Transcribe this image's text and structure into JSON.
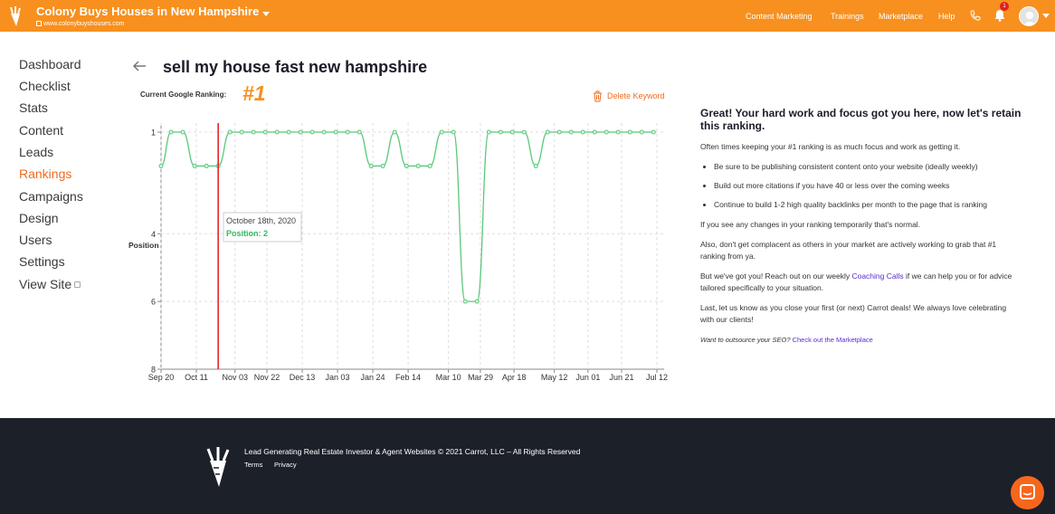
{
  "header": {
    "site_title": "Colony Buys Houses in New Hampshire",
    "site_url": "www.colonybuyshouses.com",
    "nav": [
      {
        "label": "Content Marketing"
      },
      {
        "label": "Trainings"
      },
      {
        "label": "Marketplace"
      },
      {
        "label": "Help"
      }
    ],
    "notification_count": "1",
    "brand_color": "#f7901e"
  },
  "sidebar": {
    "items": [
      {
        "label": "Dashboard"
      },
      {
        "label": "Checklist"
      },
      {
        "label": "Stats"
      },
      {
        "label": "Content"
      },
      {
        "label": "Leads"
      },
      {
        "label": "Rankings",
        "active": true
      },
      {
        "label": "Campaigns"
      },
      {
        "label": "Design"
      },
      {
        "label": "Users"
      },
      {
        "label": "Settings"
      },
      {
        "label": "View Site"
      }
    ]
  },
  "main": {
    "keyword": "sell my house fast new hampshire",
    "current_ranking_label": "Current Google Ranking:",
    "current_ranking_value": "#1",
    "delete_label": "Delete Keyword"
  },
  "chart_data": {
    "type": "line",
    "ylabel": "Position",
    "ylim": [
      8,
      1
    ],
    "y_ticks": [
      "1",
      "4",
      "6",
      "8"
    ],
    "x_ticks": [
      "Sep 20",
      "Oct 11",
      "Nov 03",
      "Nov 22",
      "Dec 13",
      "Jan 03",
      "Jan 24",
      "Feb 14",
      "Mar 10",
      "Mar 29",
      "Apr 18",
      "May 12",
      "Jun 01",
      "Jun 21",
      "Jul 12"
    ],
    "x_tick_days": [
      0,
      21,
      44,
      63,
      84,
      105,
      126,
      147,
      171,
      190,
      210,
      234,
      254,
      274,
      295
    ],
    "series": [
      {
        "color": "#5ac87a",
        "points": [
          [
            0,
            2
          ],
          [
            6,
            1
          ],
          [
            13,
            1
          ],
          [
            20,
            2
          ],
          [
            27,
            2
          ],
          [
            34,
            2
          ],
          [
            41,
            1
          ],
          [
            48,
            1
          ],
          [
            55,
            1
          ],
          [
            62,
            1
          ],
          [
            69,
            1
          ],
          [
            76,
            1
          ],
          [
            83,
            1
          ],
          [
            90,
            1
          ],
          [
            97,
            1
          ],
          [
            104,
            1
          ],
          [
            111,
            1
          ],
          [
            118,
            1
          ],
          [
            125,
            2
          ],
          [
            132,
            2
          ],
          [
            139,
            1
          ],
          [
            146,
            2
          ],
          [
            153,
            2
          ],
          [
            160,
            2
          ],
          [
            167,
            1
          ],
          [
            174,
            1
          ],
          [
            181,
            6
          ],
          [
            188,
            6
          ],
          [
            195,
            1
          ],
          [
            202,
            1
          ],
          [
            209,
            1
          ],
          [
            216,
            1
          ],
          [
            223,
            2
          ],
          [
            230,
            1
          ],
          [
            237,
            1
          ],
          [
            244,
            1
          ],
          [
            251,
            1
          ],
          [
            258,
            1
          ],
          [
            265,
            1
          ],
          [
            272,
            1
          ],
          [
            279,
            1
          ],
          [
            286,
            1
          ],
          [
            293,
            1
          ]
        ]
      }
    ],
    "marker": {
      "day": 34,
      "color": "#e8232a"
    },
    "tooltip": {
      "date": "October 18th, 2020",
      "label": "Position: 2"
    }
  },
  "panel": {
    "title": "Great! Your hard work and focus got you here, now let's retain this ranking.",
    "intro": "Often times keeping your #1 ranking is as much focus and work as getting it.",
    "bullets": [
      "Be sure to be publishing consistent content onto your website (ideally weekly)",
      "Build out more citations if you have 40 or less over the coming weeks",
      "Continue to build 1-2 high quality backlinks per month to the page that is ranking"
    ],
    "p2": "If you see any changes in your ranking temporarily that's normal.",
    "p3": "Also, don't get complacent as others in your market are actively working to grab that #1 ranking from ya.",
    "p4_before": "But we've got you! Reach out on our weekly ",
    "p4_link": "Coaching Calls",
    "p4_after": " if we can help you or for advice tailored specifically to your situation.",
    "p5": "Last, let us know as you close your first (or next) Carrot deals! We always love celebrating with our clients!",
    "p6_prefix": "Want to outsource your SEO?",
    "p6_link": "Check out the Marketplace"
  },
  "footer": {
    "text": "Lead Generating Real Estate Investor & Agent Websites © 2021 Carrot, LLC – All Rights Reserved",
    "links": [
      {
        "label": "Terms"
      },
      {
        "label": "Privacy"
      }
    ]
  }
}
